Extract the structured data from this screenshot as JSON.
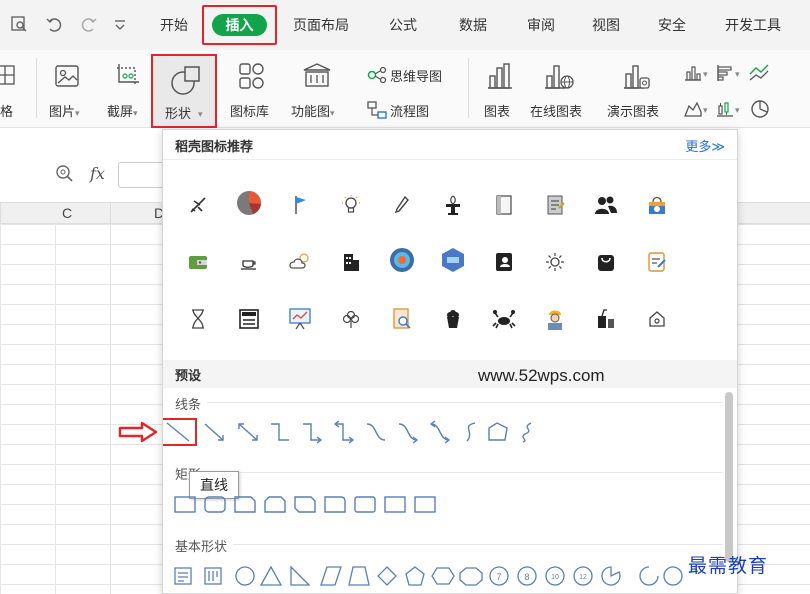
{
  "tabs": {
    "items": [
      "开始",
      "插入",
      "页面布局",
      "公式",
      "数据",
      "审阅",
      "视图",
      "安全",
      "开发工具"
    ],
    "active": "插入"
  },
  "ribbon": {
    "left_partial": "格",
    "picture": "图片",
    "screenshot": "截屏",
    "shape": "形状",
    "icon_library": "图标库",
    "function_chart": "功能图",
    "mindmap": "思维导图",
    "flowchart": "流程图",
    "chart": "图表",
    "online_chart": "在线图表",
    "demo_chart": "演示图表",
    "dropdown_arrow": "▾"
  },
  "formula": {
    "fx_label": "fx"
  },
  "columns": [
    "C",
    "D"
  ],
  "panel": {
    "title": "稻壳图标推荐",
    "more": "更多≫",
    "preset": "预设",
    "watermark": "www.52wps.com",
    "sections": {
      "lines": "线条",
      "rect": "矩形",
      "basic": "基本形状"
    },
    "tooltip": "直线"
  },
  "colors": {
    "accent_red": "#e0262b",
    "tab_green": "#13a34a",
    "link_blue": "#1e6fd9",
    "shape_stroke": "#5a7fb5"
  },
  "corner_watermark": "最需教育"
}
